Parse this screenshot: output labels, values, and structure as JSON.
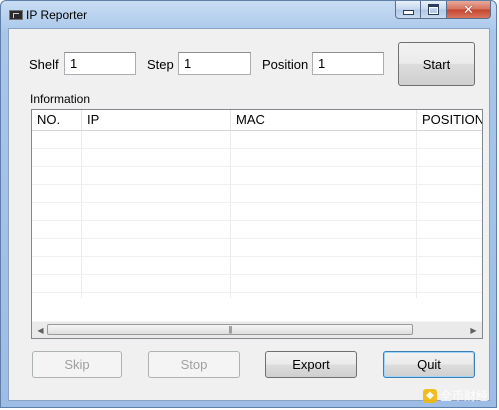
{
  "window": {
    "title": "IP Reporter",
    "accent_color": "#a8c6ea",
    "close_color": "#c5442e"
  },
  "form": {
    "shelf_label": "Shelf",
    "shelf_value": "1",
    "step_label": "Step",
    "step_value": "1",
    "position_label": "Position",
    "position_value": "1",
    "start_label": "Start"
  },
  "information": {
    "label": "Information",
    "columns": [
      "NO.",
      "IP",
      "MAC",
      "POSITION"
    ],
    "rows": []
  },
  "buttons": {
    "skip_label": "Skip",
    "stop_label": "Stop",
    "export_label": "Export",
    "quit_label": "Quit"
  },
  "watermark": {
    "text": "全币财经"
  }
}
